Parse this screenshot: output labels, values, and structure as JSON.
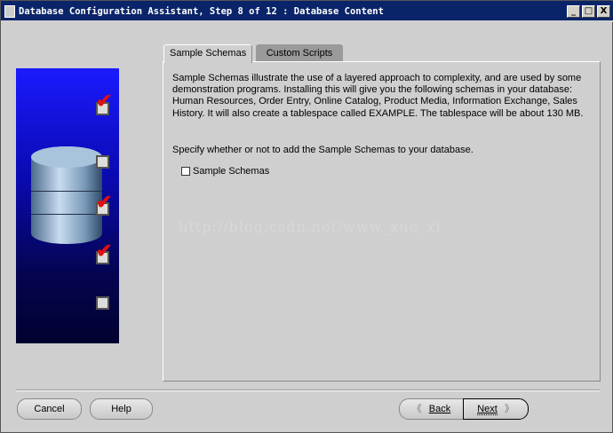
{
  "window": {
    "title": "Database Configuration Assistant, Step 8 of 12 : Database Content",
    "minimize": "_",
    "maximize": "□",
    "close": "X"
  },
  "tabs": [
    {
      "label": "Sample Schemas",
      "active": true
    },
    {
      "label": "Custom Scripts",
      "active": false
    }
  ],
  "content": {
    "description": "Sample Schemas illustrate the use of a layered approach to complexity, and are used by some demonstration programs. Installing this will give you the following schemas in your database: Human Resources, Order Entry, Online Catalog, Product Media, Information Exchange, Sales History. It will also create a tablespace called EXAMPLE. The tablespace will be about 130 MB.",
    "question": "Specify whether or not to add the Sample Schemas to your database.",
    "checkbox_label": "Sample Schemas",
    "checkbox_checked": false
  },
  "watermark": "http://blog.csdn.net/www_xue_xi",
  "steps_checked": [
    true,
    false,
    true,
    true,
    false
  ],
  "buttons": {
    "cancel": "Cancel",
    "help": "Help",
    "back_arrow": "《",
    "back": "Back",
    "next": "Next",
    "next_arrow": "》"
  }
}
